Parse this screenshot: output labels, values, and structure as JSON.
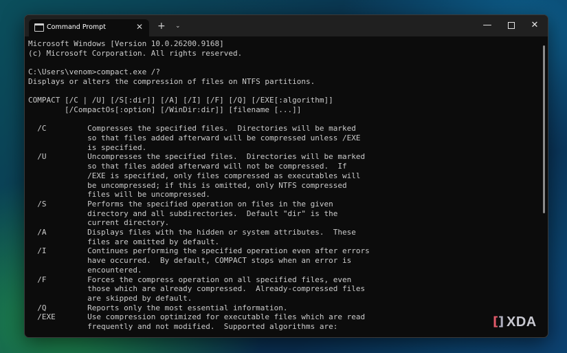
{
  "window": {
    "tab_title": "Command Prompt",
    "tab_close_glyph": "✕",
    "new_tab_glyph": "+",
    "dropdown_glyph": "⌄",
    "minimize_glyph": "—",
    "close_glyph": "✕"
  },
  "terminal": {
    "lines": [
      "Microsoft Windows [Version 10.0.26200.9168]",
      "(c) Microsoft Corporation. All rights reserved.",
      "",
      "C:\\Users\\venom>compact.exe /?",
      "Displays or alters the compression of files on NTFS partitions.",
      "",
      "COMPACT [/C | /U] [/S[:dir]] [/A] [/I] [/F] [/Q] [/EXE[:algorithm]]",
      "        [/CompactOs[:option] [/WinDir:dir]] [filename [...]]",
      "",
      "  /C         Compresses the specified files.  Directories will be marked",
      "             so that files added afterward will be compressed unless /EXE",
      "             is specified.",
      "  /U         Uncompresses the specified files.  Directories will be marked",
      "             so that files added afterward will not be compressed.  If",
      "             /EXE is specified, only files compressed as executables will",
      "             be uncompressed; if this is omitted, only NTFS compressed",
      "             files will be uncompressed.",
      "  /S         Performs the specified operation on files in the given",
      "             directory and all subdirectories.  Default \"dir\" is the",
      "             current directory.",
      "  /A         Displays files with the hidden or system attributes.  These",
      "             files are omitted by default.",
      "  /I         Continues performing the specified operation even after errors",
      "             have occurred.  By default, COMPACT stops when an error is",
      "             encountered.",
      "  /F         Forces the compress operation on all specified files, even",
      "             those which are already compressed.  Already-compressed files",
      "             are skipped by default.",
      "  /Q         Reports only the most essential information.",
      "  /EXE       Use compression optimized for executable files which are read",
      "             frequently and not modified.  Supported algorithms are:"
    ]
  },
  "watermark": {
    "text": "XDA"
  }
}
